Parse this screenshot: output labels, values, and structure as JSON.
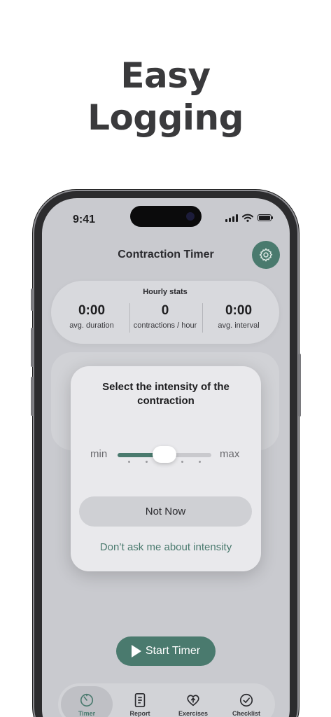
{
  "headline": {
    "line1": "Easy",
    "line2": "Logging"
  },
  "status_bar": {
    "time": "9:41"
  },
  "app": {
    "title": "Contraction Timer",
    "settings_icon": "gear-icon"
  },
  "hourly_stats": {
    "title": "Hourly stats",
    "items": [
      {
        "value": "0:00",
        "label": "avg. duration"
      },
      {
        "value": "0",
        "label": "contractions / hour"
      },
      {
        "value": "0:00",
        "label": "avg. interval"
      }
    ]
  },
  "intensity_modal": {
    "title": "Select the intensity of the contraction",
    "min_label": "min",
    "max_label": "max",
    "slider_value": 0.5,
    "not_now_label": "Not Now",
    "dont_ask_label": "Don’t ask me about intensity"
  },
  "start_button": {
    "label": "Start Timer"
  },
  "tabs": [
    {
      "label": "Timer",
      "icon": "timer-icon",
      "active": true
    },
    {
      "label": "Report",
      "icon": "report-icon",
      "active": false
    },
    {
      "label": "Exercises",
      "icon": "heart-arrow-icon",
      "active": false
    },
    {
      "label": "Checklist",
      "icon": "checkmark-circle-icon",
      "active": false
    }
  ],
  "colors": {
    "accent": "#4a7a6e",
    "screen_bg": "#c9cacf",
    "modal_bg": "#e9e9ec"
  }
}
